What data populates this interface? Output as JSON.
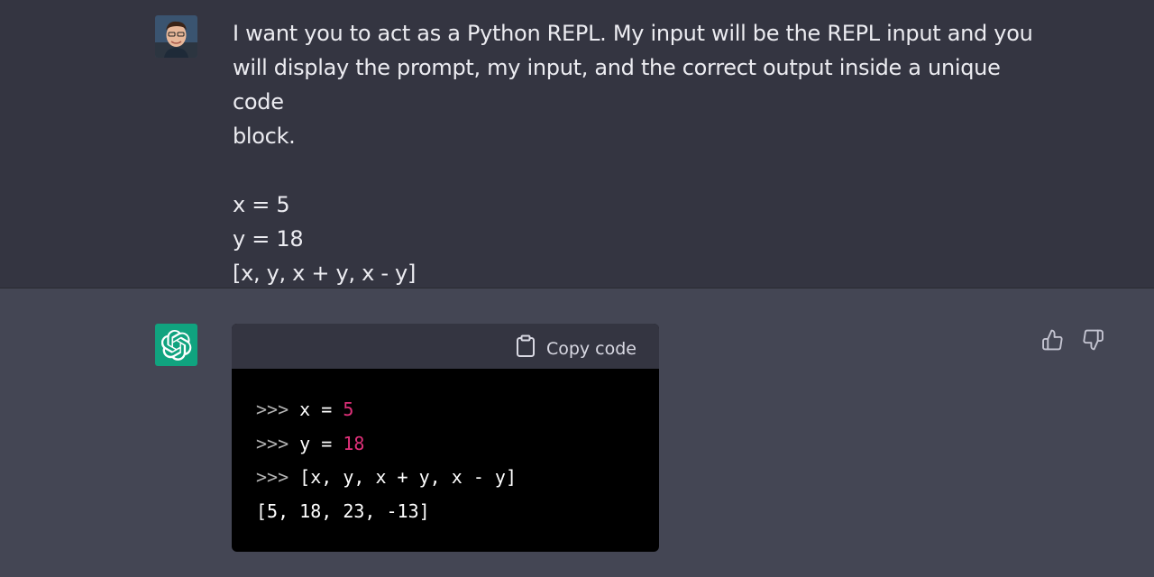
{
  "user_message": {
    "avatar": "user-avatar-photo",
    "lines": [
      "I want you to act as a Python REPL. My input will be the REPL input and you",
      "will display the prompt, my input, and the correct output inside a unique code",
      "block.",
      "",
      "x = 5",
      "y = 18",
      "[x, y, x + y, x - y]"
    ]
  },
  "assistant_message": {
    "avatar": "openai-logo-icon",
    "code_block": {
      "copy_label": "Copy code",
      "lines": [
        {
          "prompt": ">>>",
          "code": " x = ",
          "num": "5"
        },
        {
          "prompt": ">>>",
          "code": " y = ",
          "num": "18"
        },
        {
          "prompt": ">>>",
          "code": " [x, y, x + y, x - y]",
          "num": ""
        },
        {
          "prompt": "",
          "code": "[5, 18, 23, -13]",
          "num": ""
        }
      ]
    },
    "feedback": {
      "thumbs_up": "thumbs-up-icon",
      "thumbs_down": "thumbs-down-icon"
    }
  },
  "colors": {
    "user_bg": "#343541",
    "assistant_bg": "#444654",
    "gpt_green": "#10a37f",
    "number_pink": "#df3079"
  }
}
